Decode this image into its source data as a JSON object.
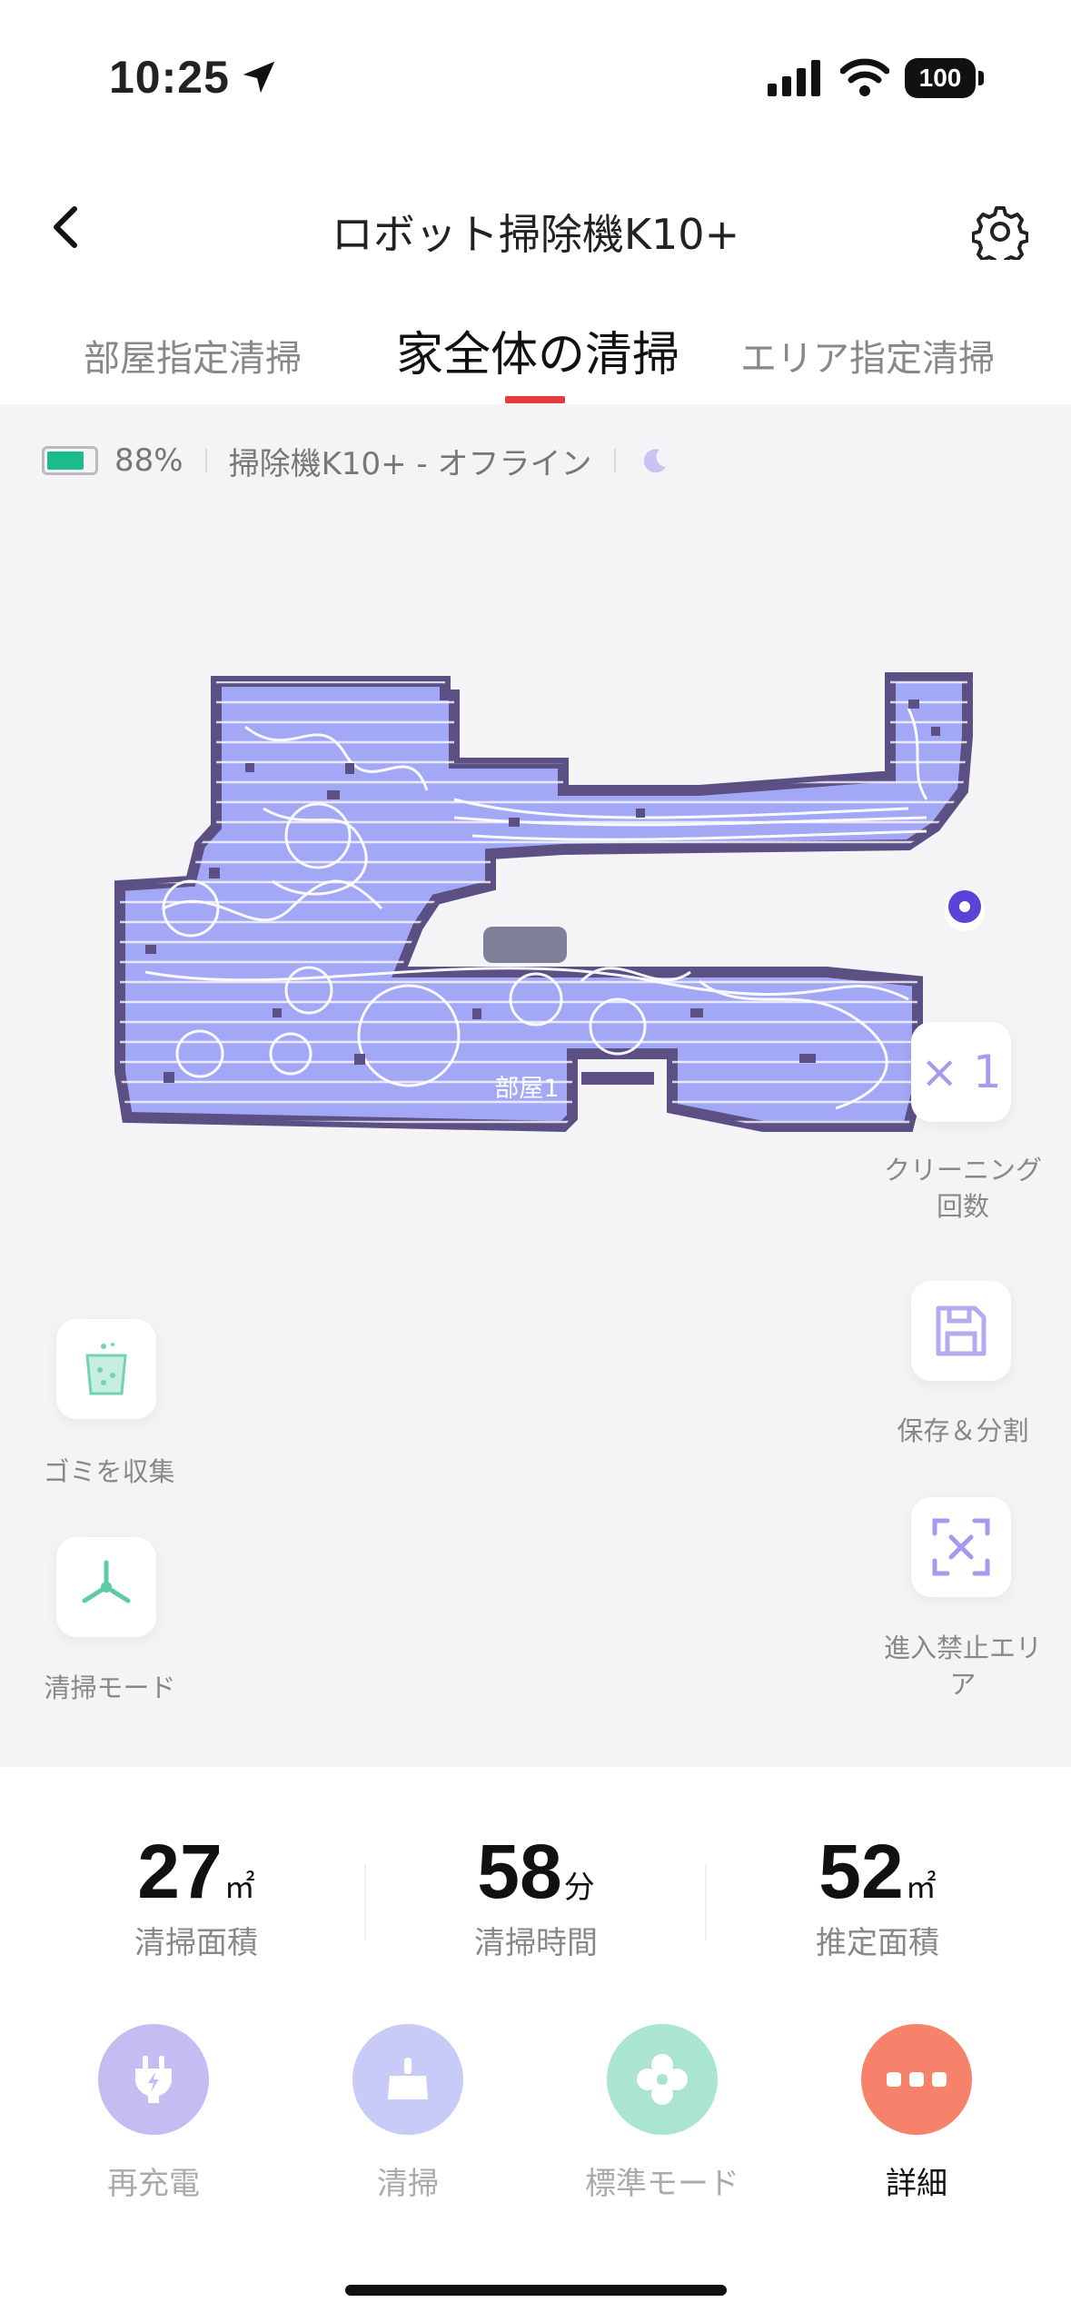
{
  "status_bar": {
    "time": "10:25",
    "battery": "100"
  },
  "header": {
    "title": "ロボット掃除機K10+"
  },
  "tabs": [
    {
      "label": "部屋指定清掃",
      "active": false
    },
    {
      "label": "家全体の清掃",
      "active": true
    },
    {
      "label": "エリア指定清掃",
      "active": false
    }
  ],
  "device_info": {
    "battery_percent": "88%",
    "status_text": "掃除機K10+ - オフライン"
  },
  "map": {
    "room_label": "部屋1"
  },
  "right_controls": {
    "cleaning_count_value": "× 1",
    "cleaning_count_label_line1": "クリーニング",
    "cleaning_count_label_line2": "回数",
    "save_split_label": "保存＆分割",
    "no_go_label_line1": "進入禁止エリ",
    "no_go_label_line2": "ア"
  },
  "left_controls": {
    "dust_collect_label": "ゴミを収集",
    "clean_mode_label": "清掃モード"
  },
  "stats": [
    {
      "value": "27",
      "unit": "㎡",
      "label": "清掃面積"
    },
    {
      "value": "58",
      "unit": "分",
      "label": "清掃時間"
    },
    {
      "value": "52",
      "unit": "㎡",
      "label": "推定面積"
    }
  ],
  "actions": [
    {
      "label": "再充電",
      "color": "#c4b8f2"
    },
    {
      "label": "清掃",
      "color": "#c5c8f6"
    },
    {
      "label": "標準モード",
      "color": "#a8e4cf"
    },
    {
      "label": "詳細",
      "color": "#f6826b"
    }
  ],
  "colors": {
    "accent_red": "#e53a3e",
    "map_fill": "#a3a8f5",
    "map_wall": "#5b4f84"
  }
}
